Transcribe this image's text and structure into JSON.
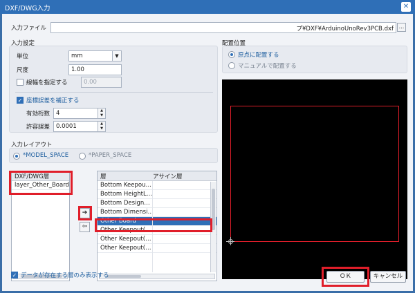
{
  "window": {
    "title": "DXF/DWG入力",
    "close_glyph": "✕"
  },
  "input_file": {
    "label": "入力ファイル",
    "value": "プ¥DXF¥ArduinoUnoRev3PCB.dxf",
    "browse_label": "..."
  },
  "input_settings": {
    "heading": "入力設定",
    "unit": {
      "label": "単位",
      "value": "mm"
    },
    "scale": {
      "label": "尺度",
      "value": "1.00"
    },
    "line_width": {
      "label": "線幅を指定する",
      "checked": false,
      "value": "0.00"
    },
    "coord_correction": {
      "label": "座標誤差を補正する",
      "checked": true
    },
    "digits": {
      "label": "有効桁数",
      "value": "4"
    },
    "tolerance": {
      "label": "許容誤差",
      "value": "0.0001"
    }
  },
  "layout": {
    "heading": "入力レイアウト",
    "options": [
      {
        "label": "*MODEL_SPACE",
        "selected": true
      },
      {
        "label": "*PAPER_SPACE",
        "selected": false
      }
    ]
  },
  "source_list": {
    "header": "DXF/DWG層",
    "items": [
      "layer_Other_Board"
    ]
  },
  "target_list": {
    "headers": [
      "層",
      "アサイン層"
    ],
    "rows": [
      {
        "layer": "Bottom Keepou…",
        "assign": ""
      },
      {
        "layer": "Bottom HeightL…",
        "assign": ""
      },
      {
        "layer": "Bottom Design…",
        "assign": ""
      },
      {
        "layer": "Bottom Dimensi…",
        "assign": ""
      },
      {
        "layer": "Other Board",
        "assign": "",
        "selected": true
      },
      {
        "layer": "Other Keepout(…",
        "assign": ""
      },
      {
        "layer": "Other Keepout(…",
        "assign": ""
      },
      {
        "layer": "Other Keepout(…",
        "assign": ""
      }
    ]
  },
  "arrows": {
    "right": "➔",
    "left": "⇦"
  },
  "show_data_only": {
    "label": "データが存在する層のみ表示する",
    "checked": true
  },
  "placement": {
    "heading": "配置位置",
    "options": [
      {
        "label": "原点に配置する",
        "selected": true
      },
      {
        "label": "マニュアルで配置する",
        "selected": false
      }
    ]
  },
  "buttons": {
    "ok": "ＯＫ",
    "cancel": "キャンセル"
  },
  "colors": {
    "title_bar": "#2f6fb7",
    "highlight_box": "#e01e2a",
    "selection": "#2f6fb7",
    "preview_bg": "#000000"
  }
}
